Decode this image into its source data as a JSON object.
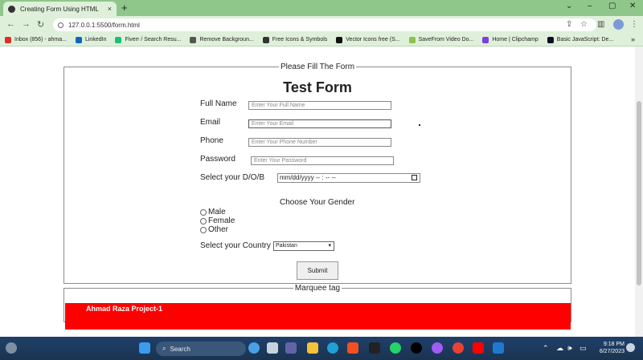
{
  "browser": {
    "tab_title": "Creating Form Using HTML",
    "tab_close": "×",
    "new_tab": "+",
    "url": "127.0.0.1:5500/form.html",
    "window_controls": [
      "⌄",
      "–",
      "▢",
      "✕"
    ],
    "bookmarks": [
      {
        "label": "Inbox (856) - ahma...",
        "color": "#d93025"
      },
      {
        "label": "LinkedIn",
        "color": "#0a66c2"
      },
      {
        "label": "Fiverr / Search Resu...",
        "color": "#1dbf73"
      },
      {
        "label": "Remove Backgroun...",
        "color": "#555555"
      },
      {
        "label": "Free Icons & Symbols",
        "color": "#333333"
      },
      {
        "label": "Vector Icons free (S...",
        "color": "#111111"
      },
      {
        "label": "SaveFrom Video Do...",
        "color": "#8bc34a"
      },
      {
        "label": "Home | Clipchamp",
        "color": "#7b3fe4"
      },
      {
        "label": "Basic JavaScript: De...",
        "color": "#0a0a23"
      }
    ],
    "bookmarks_more": "»"
  },
  "form": {
    "legend": "Please Fill The Form",
    "title": "Test Form",
    "full_name_label": "Full Name",
    "full_name_placeholder": "Enter Your Full Name",
    "email_label": "Email",
    "email_placeholder": "Enter Your Email",
    "phone_label": "Phone",
    "phone_placeholder": "Enter Your Phone Number",
    "password_label": "Password",
    "password_placeholder": "Enter Your Password",
    "dob_label": "Select your D/O/B",
    "dob_value": "mm/dd/yyyy -- : -- --",
    "gender_heading": "Choose Your Gender",
    "gender_options": [
      "Male",
      "Female",
      "Other"
    ],
    "country_label": "Select your Country",
    "country_value": "Pakistan",
    "submit_label": "Submit"
  },
  "marquee": {
    "legend": "Marquee tag",
    "text": "Ahmad Raza Project-1",
    "background": "#ff0000"
  },
  "taskbar": {
    "search_label": "Search",
    "time": "9:18 PM",
    "date": "6/27/2023"
  }
}
